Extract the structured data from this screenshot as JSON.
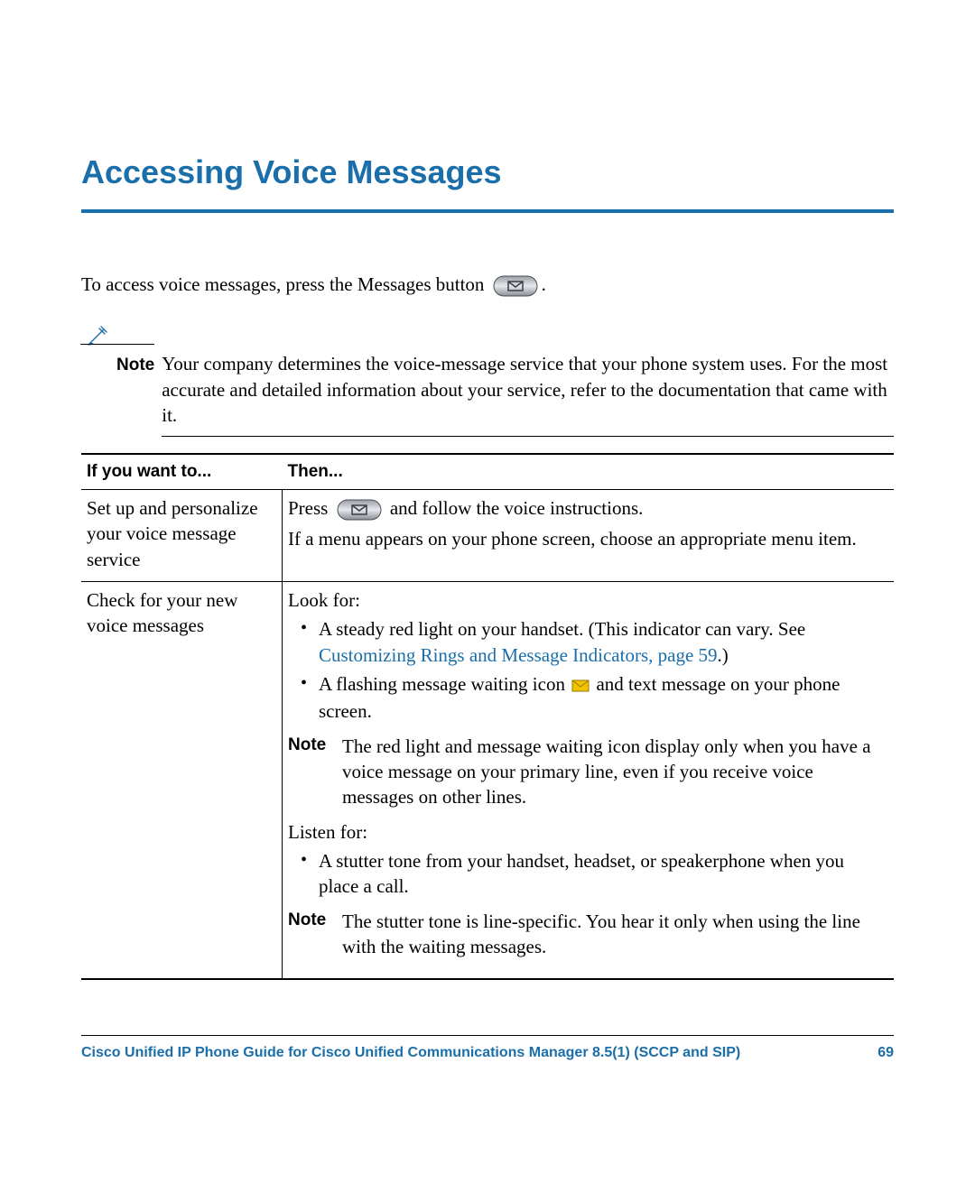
{
  "title": "Accessing Voice Messages",
  "intro_pre": "To access voice messages, press the Messages button ",
  "intro_post": ".",
  "note": {
    "label": "Note",
    "text": "Your company determines the voice-message service that your phone system uses. For the most accurate and detailed information about your service, refer to the documentation that came with it."
  },
  "table": {
    "headers": [
      "If you want to...",
      "Then..."
    ],
    "rows": [
      {
        "want": "Set up and personalize your voice message service",
        "then": {
          "press_pre": "Press ",
          "press_post": " and follow the voice instructions.",
          "line2": "If a menu appears on your phone screen, choose an appropriate menu item."
        }
      },
      {
        "want": "Check for your new voice messages",
        "then": {
          "look_for": "Look for:",
          "look1_pre": "A steady red light on your handset. (This indicator can vary. See ",
          "look1_link": "Customizing Rings and Message Indicators, page 59",
          "look1_post": ".)",
          "look2_pre": "A flashing message waiting icon ",
          "look2_post": " and text message on your phone screen.",
          "note1_label": "Note",
          "note1_text": "The red light and message waiting icon display only when you have a voice message on your primary line, even if you receive voice messages on other lines.",
          "listen_for": "Listen for:",
          "listen1": "A stutter tone from your handset, headset, or speakerphone when you place a call.",
          "note2_label": "Note",
          "note2_text": "The stutter tone is line-specific. You hear it only when using the line with the waiting messages."
        }
      }
    ]
  },
  "footer": {
    "doc_title": "Cisco Unified IP Phone Guide for Cisco Unified Communications Manager 8.5(1) (SCCP and SIP)",
    "page_number": "69"
  }
}
